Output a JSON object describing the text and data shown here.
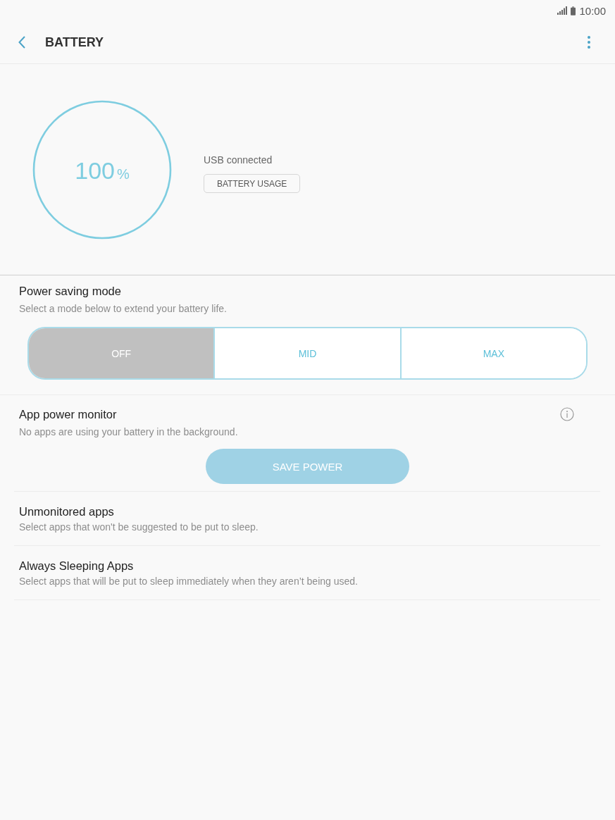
{
  "status_bar": {
    "time": "10:00"
  },
  "header": {
    "title": "BATTERY"
  },
  "battery": {
    "level": 1,
    "percent": "100",
    "unit": "%",
    "status": "USB connected",
    "usage_button": "BATTERY USAGE"
  },
  "power_saving": {
    "title": "Power saving mode",
    "subtitle": "Select a mode below to extend your battery life.",
    "modes": [
      {
        "label": "OFF",
        "selected": true
      },
      {
        "label": "MID",
        "selected": false
      },
      {
        "label": "MAX",
        "selected": false
      }
    ]
  },
  "app_power_monitor": {
    "title": "App power monitor",
    "subtitle": "No apps are using your battery in the background.",
    "button": {
      "label": "SAVE POWER",
      "disabled": true
    }
  },
  "settings": [
    {
      "title": "Unmonitored apps",
      "subtitle": "Select apps that won't be suggested to be put to sleep."
    },
    {
      "title": "Always Sleeping Apps",
      "subtitle": "Select apps that will be put to sleep immediately when they aren’t being used."
    }
  ]
}
